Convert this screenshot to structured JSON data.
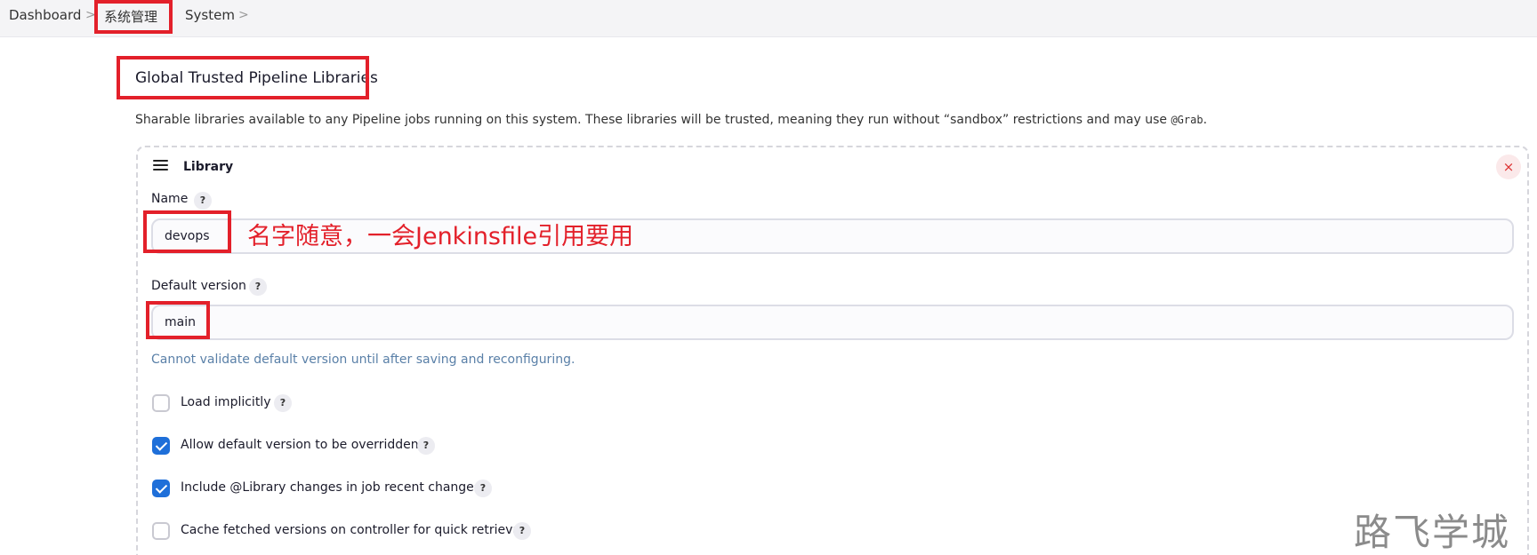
{
  "breadcrumb": {
    "items": [
      "Dashboard",
      "系统管理",
      "System"
    ],
    "separator": ">"
  },
  "section": {
    "title": "Global Trusted Pipeline Libraries",
    "description_prefix": "Sharable libraries available to any Pipeline jobs running on this system. These libraries will be trusted, meaning they run without “sandbox” restrictions and may use ",
    "description_code": "@Grab",
    "description_suffix": "."
  },
  "library": {
    "title": "Library",
    "delete_icon": "×",
    "name_label": "Name",
    "name_value": "devops",
    "default_version_label": "Default version",
    "default_version_value": "main",
    "validation_note": "Cannot validate default version until after saving and reconfiguring.",
    "help_glyph": "?",
    "checkboxes": [
      {
        "label": "Load implicitly",
        "checked": false
      },
      {
        "label": "Allow default version to be overridden",
        "checked": true
      },
      {
        "label": "Include @Library changes in job recent changes",
        "checked": true
      },
      {
        "label": "Cache fetched versions on controller for quick retrieval",
        "checked": false
      }
    ]
  },
  "annotation": "名字随意，一会Jenkinsfile引用要用",
  "watermark": "路飞学城",
  "colors": {
    "accent": "#1e6fd9",
    "highlight_box": "#e3202a",
    "note_text": "#5a80a8"
  },
  "icons": {
    "drag": "drag-handle-icon",
    "delete": "close-icon",
    "help": "help-icon",
    "checkmark": "checkmark-icon"
  }
}
